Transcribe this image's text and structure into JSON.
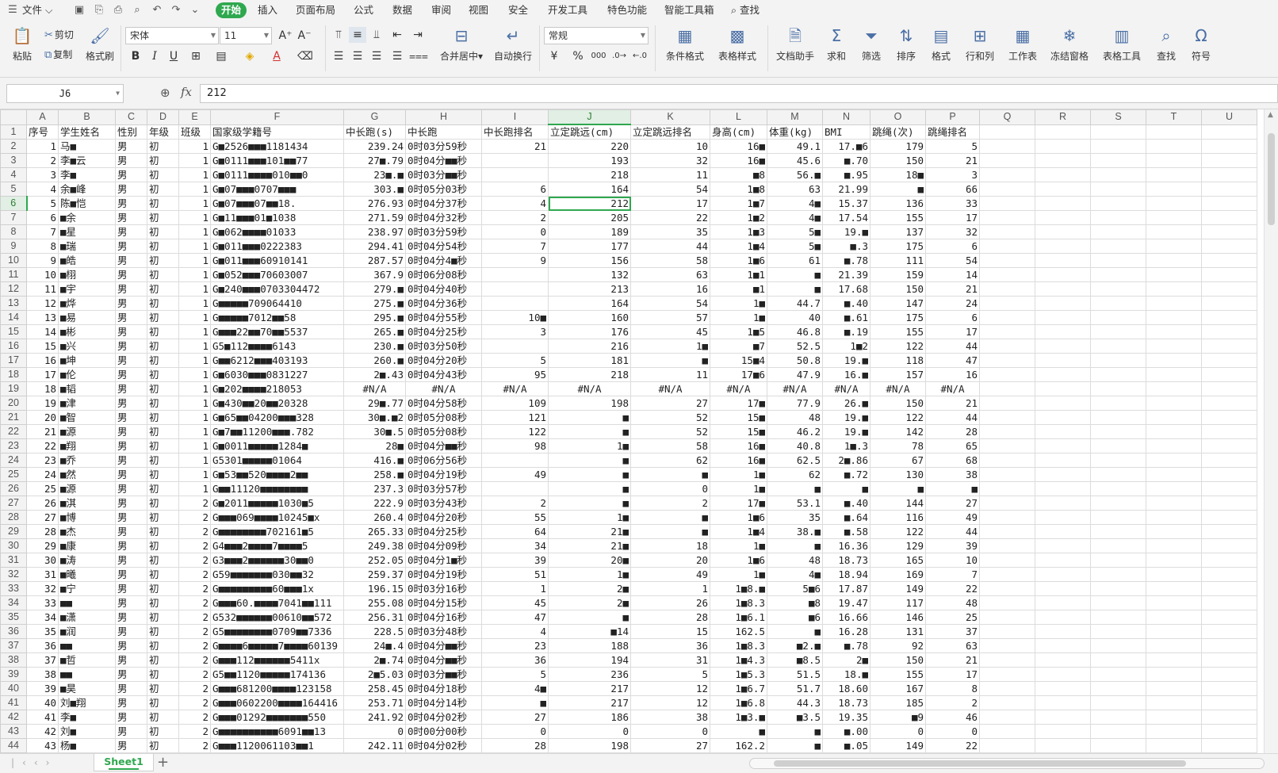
{
  "menubar": {
    "file_label": "文件",
    "tabs": [
      "开始",
      "插入",
      "页面布局",
      "公式",
      "数据",
      "审阅",
      "视图",
      "安全",
      "开发工具",
      "特色功能",
      "智能工具箱"
    ],
    "active_tab": "开始",
    "search_label": "查找"
  },
  "ribbon": {
    "paste": "粘贴",
    "cut": "剪切",
    "copy": "复制",
    "format_painter": "格式刷",
    "font_name": "宋体",
    "font_size": "11",
    "merge_center": "合并居中",
    "wrap_text": "自动换行",
    "number_format": "常规",
    "conditional_format": "条件格式",
    "table_style": "表格样式",
    "doc_helper": "文档助手",
    "sum": "求和",
    "filter": "筛选",
    "sort": "排序",
    "format": "格式",
    "rows_cols": "行和列",
    "worksheet": "工作表",
    "freeze": "冻结窗格",
    "table_tools": "表格工具",
    "find": "查找",
    "symbol": "符号"
  },
  "formula_bar": {
    "name_box": "J6",
    "fx_label": "fx",
    "formula": "212"
  },
  "sheet": {
    "col_letters": [
      "A",
      "B",
      "C",
      "D",
      "E",
      "F",
      "G",
      "H",
      "I",
      "J",
      "K",
      "L",
      "M",
      "N",
      "O",
      "P",
      "Q",
      "R",
      "S",
      "T",
      "U"
    ],
    "selected_col": "J",
    "selected_row": 6,
    "headers": [
      "序号",
      "学生姓名",
      "性别",
      "年级",
      "班级",
      "国家级学籍号",
      "中长跑(s)",
      "中长跑",
      "中长跑排名",
      "立定跳远(cm)",
      "立定跳远排名",
      "身高(cm)",
      "体重(kg)",
      "BMI",
      "跳绳(次)",
      "跳绳排名"
    ],
    "rows": [
      [
        "1",
        "马■",
        "男",
        "初",
        "1",
        "G■2526■■■1181434",
        "239.24",
        "0时03分59秒",
        "21",
        "220",
        "10",
        "16■",
        "49.1",
        "17.■6",
        "179",
        "5"
      ],
      [
        "2",
        "李■云",
        "男",
        "初",
        "1",
        "G■0111■■■101■■77",
        "27■.79",
        "0时04分■■秒",
        "",
        "193",
        "32",
        "16■",
        "45.6",
        "■.70",
        "150",
        "21"
      ],
      [
        "3",
        "李■",
        "男",
        "初",
        "1",
        "G■0111■■■■010■■0",
        "23■.■",
        "0时03分■■秒",
        "",
        "218",
        "11",
        "■8",
        "56.■",
        "■.95",
        "18■",
        "3"
      ],
      [
        "4",
        "余■峰",
        "男",
        "初",
        "1",
        "G■07■■■0707■■■",
        "303.■",
        "0时05分03秒",
        "6",
        "164",
        "54",
        "1■8",
        "63",
        "21.99",
        "■",
        "66"
      ],
      [
        "5",
        "陈■恺",
        "男",
        "初",
        "1",
        "G■07■■■07■■18.",
        "276.93",
        "0时04分37秒",
        "4",
        "212",
        "17",
        "1■7",
        "4■",
        "15.37",
        "136",
        "33"
      ],
      [
        "6",
        "■余",
        "男",
        "初",
        "1",
        "G■11■■■01■1038",
        "271.59",
        "0时04分32秒",
        "2",
        "205",
        "22",
        "1■2",
        "4■",
        "17.54",
        "155",
        "17"
      ],
      [
        "7",
        "■星",
        "男",
        "初",
        "1",
        "G■062■■■■01033",
        "238.97",
        "0时03分59秒",
        "0",
        "189",
        "35",
        "1■3",
        "5■",
        "19.■",
        "137",
        "32"
      ],
      [
        "8",
        "■瑞",
        "男",
        "初",
        "1",
        "G■011■■■0222383",
        "294.41",
        "0时04分54秒",
        "7",
        "177",
        "44",
        "1■4",
        "5■",
        "■.3",
        "175",
        "6"
      ],
      [
        "9",
        "■皓",
        "男",
        "初",
        "1",
        "G■011■■■60910141",
        "287.57",
        "0时04分4■秒",
        "9",
        "156",
        "58",
        "1■6",
        "61",
        "■.78",
        "111",
        "54"
      ],
      [
        "10",
        "■栩",
        "男",
        "初",
        "1",
        "G■052■■■70603007",
        "367.9",
        "0时06分08秒",
        "",
        "132",
        "63",
        "1■1",
        "■",
        "21.39",
        "159",
        "14"
      ],
      [
        "11",
        "■宇",
        "男",
        "初",
        "1",
        "G■240■■■0703304472",
        "279.■",
        "0时04分40秒",
        "",
        "213",
        "16",
        "■1",
        "■",
        "17.68",
        "150",
        "21"
      ],
      [
        "12",
        "■烨",
        "男",
        "初",
        "1",
        "G■■■■■709064410",
        "275.■",
        "0时04分36秒",
        "",
        "164",
        "54",
        "1■",
        "44.7",
        "■.40",
        "147",
        "24"
      ],
      [
        "13",
        "■易",
        "男",
        "初",
        "1",
        "G■■■■■7012■■58",
        "295.■",
        "0时04分55秒",
        "10■",
        "160",
        "57",
        "1■",
        "40",
        "■.61",
        "175",
        "6"
      ],
      [
        "14",
        "■彬",
        "男",
        "初",
        "1",
        "G■■■22■■70■■5537",
        "265.■",
        "0时04分25秒",
        "3",
        "176",
        "45",
        "1■5",
        "46.8",
        "■.19",
        "155",
        "17"
      ],
      [
        "15",
        "■兴",
        "男",
        "初",
        "1",
        "G5■112■■■■6143",
        "230.■",
        "0时03分50秒",
        "",
        "216",
        "1■",
        "■7",
        "52.5",
        "1■2",
        "122",
        "44"
      ],
      [
        "16",
        "■坤",
        "男",
        "初",
        "1",
        "G■■6212■■■403193",
        "260.■",
        "0时04分20秒",
        "5",
        "181",
        "■",
        "15■4",
        "50.8",
        "19.■",
        "118",
        "47"
      ],
      [
        "17",
        "■伦",
        "男",
        "初",
        "1",
        "G■6030■■■0831227",
        "2■.43",
        "0时04分43秒",
        "95",
        "218",
        "11",
        "17■6",
        "47.9",
        "16.■",
        "157",
        "16"
      ],
      [
        "18",
        "■韬",
        "男",
        "初",
        "1",
        "G■202■■■■218053",
        "#N/A",
        "#N/A",
        "#N/A",
        "#N/A",
        "#N/A",
        "#N/A",
        "#N/A",
        "#N/A",
        "#N/A",
        "#N/A"
      ],
      [
        "19",
        "■津",
        "男",
        "初",
        "1",
        "G■430■■20■■20328",
        "29■.77",
        "0时04分58秒",
        "109",
        "198",
        "27",
        "17■",
        "77.9",
        "26.■",
        "150",
        "21"
      ],
      [
        "20",
        "■智",
        "男",
        "初",
        "1",
        "G■65■■04200■■■328",
        "30■.■2",
        "0时05分08秒",
        "121",
        "■",
        "52",
        "15■",
        "48",
        "19.■",
        "122",
        "44"
      ],
      [
        "21",
        "■源",
        "男",
        "初",
        "1",
        "G■7■■11200■■■.782",
        "30■.5",
        "0时05分08秒",
        "122",
        "■",
        "52",
        "15■",
        "46.2",
        "19.■",
        "142",
        "28"
      ],
      [
        "22",
        "■翔",
        "男",
        "初",
        "1",
        "G■0011■■■■■1284■",
        "28■",
        "0时04分■■秒",
        "98",
        "1■",
        "58",
        "16■",
        "40.8",
        "1■.3",
        "78",
        "65"
      ],
      [
        "23",
        "■乔",
        "男",
        "初",
        "1",
        "G5301■■■■■01064",
        "416.■",
        "0时06分56秒",
        "",
        "■",
        "62",
        "16■",
        "62.5",
        "2■.86",
        "67",
        "68"
      ],
      [
        "24",
        "■然",
        "男",
        "初",
        "1",
        "G■53■■520■■■■2■■",
        "258.■",
        "0时04分19秒",
        "49",
        "■",
        "■",
        "1■",
        "62",
        "■.72",
        "130",
        "38"
      ],
      [
        "25",
        "■源",
        "男",
        "初",
        "1",
        "G■■11120■■■■■■■■",
        "237.3",
        "0时03分57秒",
        "",
        "■",
        "0",
        "1■",
        "■",
        "■",
        "■",
        "■"
      ],
      [
        "26",
        "■淇",
        "男",
        "初",
        "2",
        "G■2011■■■■■1030■5",
        "222.9",
        "0时03分43秒",
        "2",
        "■",
        "2",
        "17■",
        "53.1",
        "■.40",
        "144",
        "27"
      ],
      [
        "27",
        "■博",
        "男",
        "初",
        "2",
        "G■■■069■■■■10245■x",
        "260.4",
        "0时04分20秒",
        "55",
        "1■",
        "■",
        "1■6",
        "35",
        "■.64",
        "116",
        "49"
      ],
      [
        "28",
        "■杰",
        "男",
        "初",
        "2",
        "G■■■■■■■■702161■5",
        "265.33",
        "0时04分25秒",
        "64",
        "21■",
        "■",
        "1■4",
        "38.■",
        "■.58",
        "122",
        "44"
      ],
      [
        "29",
        "■康",
        "男",
        "初",
        "2",
        "G4■■■2■■■■7■■■■5",
        "249.38",
        "0时04分09秒",
        "34",
        "21■",
        "18",
        "1■",
        "■",
        "16.36",
        "129",
        "39"
      ],
      [
        "30",
        "■涛",
        "男",
        "初",
        "2",
        "G3■■■2■■■■■■30■■0",
        "252.05",
        "0时04分1■秒",
        "39",
        "20■",
        "20",
        "1■6",
        "48",
        "18.73",
        "165",
        "10"
      ],
      [
        "31",
        "■曦",
        "男",
        "初",
        "2",
        "G59■■■■■■■030■■32",
        "259.37",
        "0时04分19秒",
        "51",
        "1■",
        "49",
        "1■",
        "4■",
        "18.94",
        "169",
        "7"
      ],
      [
        "32",
        "■宁",
        "男",
        "初",
        "2",
        "G■■■■■■■■■60■■■1x",
        "196.15",
        "0时03分16秒",
        "1",
        "2■",
        "1",
        "1■8.■",
        "5■6",
        "17.87",
        "149",
        "22"
      ],
      [
        "33",
        "■■",
        "男",
        "初",
        "2",
        "G■■■60.■■■■7041■■111",
        "255.08",
        "0时04分15秒",
        "45",
        "2■",
        "26",
        "1■8.3",
        "■8",
        "19.47",
        "117",
        "48"
      ],
      [
        "34",
        "■潇",
        "男",
        "初",
        "2",
        "G532■■■■■■00610■■572",
        "256.31",
        "0时04分16秒",
        "47",
        "■",
        "28",
        "1■6.1",
        "■6",
        "16.66",
        "146",
        "25"
      ],
      [
        "35",
        "■润",
        "男",
        "初",
        "2",
        "G5■■■■■■■■0709■■7336",
        "228.5",
        "0时03分48秒",
        "4",
        "■14",
        "15",
        "162.5",
        "■",
        "16.28",
        "131",
        "37"
      ],
      [
        "36",
        "■■",
        "男",
        "初",
        "2",
        "G■■■■6■■■■■7■■■■60139",
        "24■.4",
        "0时04分■■秒",
        "23",
        "188",
        "36",
        "1■8.3",
        "■2.■",
        "■.78",
        "92",
        "63"
      ],
      [
        "37",
        "■哲",
        "男",
        "初",
        "2",
        "G■■■112■■■■■■5411x",
        "2■.74",
        "0时04分■■秒",
        "36",
        "194",
        "31",
        "1■4.3",
        "■8.5",
        "2■",
        "150",
        "21"
      ],
      [
        "38",
        "■■",
        "男",
        "初",
        "2",
        "G5■■1120■■■■■174136",
        "2■5.03",
        "0时03分■■秒",
        "5",
        "236",
        "5",
        "1■5.3",
        "51.5",
        "18.■",
        "155",
        "17"
      ],
      [
        "39",
        "■昊",
        "男",
        "初",
        "2",
        "G■■■681200■■■■123158",
        "258.45",
        "0时04分18秒",
        "4■",
        "217",
        "12",
        "1■6.7",
        "51.7",
        "18.60",
        "167",
        "8"
      ],
      [
        "40",
        "刘■翔",
        "男",
        "初",
        "2",
        "G■■■0602200■■■■164416",
        "253.71",
        "0时04分14秒",
        "■",
        "217",
        "12",
        "1■6.8",
        "44.3",
        "18.73",
        "185",
        "2"
      ],
      [
        "41",
        "李■",
        "男",
        "初",
        "2",
        "G■■■01292■■■■■■■550",
        "241.92",
        "0时04分02秒",
        "27",
        "186",
        "38",
        "1■3.■",
        "■3.5",
        "19.35",
        "■9",
        "46"
      ],
      [
        "42",
        "刘■",
        "男",
        "初",
        "2",
        "G■■■■■■■■■■6091■■13",
        "0",
        "0时00分00秒",
        "0",
        "0",
        "0",
        "■",
        "■",
        "■.00",
        "0",
        "0"
      ],
      [
        "43",
        "杨■",
        "男",
        "初",
        "2",
        "G■■■1120061103■■1",
        "242.11",
        "0时04分02秒",
        "28",
        "198",
        "27",
        "162.2",
        "■",
        "■.05",
        "149",
        "22"
      ]
    ]
  },
  "status_bar": {
    "sheet_tab": "Sheet1",
    "add_sheet": "+"
  }
}
